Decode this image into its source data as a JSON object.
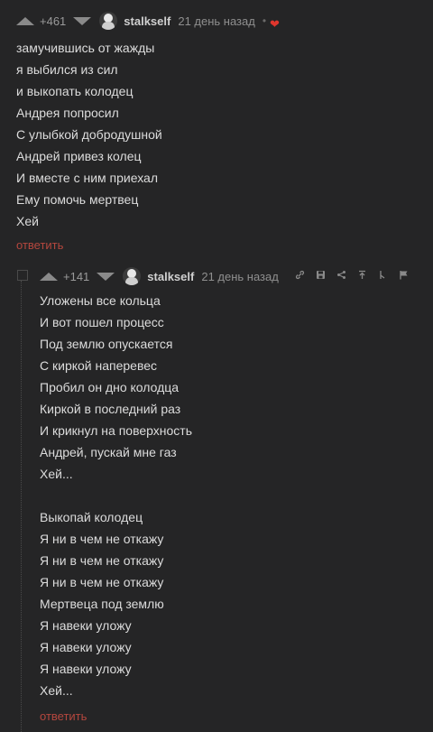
{
  "comments": [
    {
      "rating": "+461",
      "author": "stalkself",
      "time": "21 день назад",
      "body": "замучившись от жажды\nя выбился из сил\nи выкопать колодец\nАндрея попросил\nС улыбкой добродушной\nАндрей привез колец\nИ вместе с ним приехал\nЕму помочь мертвец\nХей",
      "reply": "ответить",
      "heart_icon": "heart-icon",
      "heart_color": "#e0362d"
    },
    {
      "rating": "+141",
      "author": "stalkself",
      "time": "21 день назад",
      "body": "Уложены все кольца\nИ вот пошел процесс\nПод землю опускается\nС киркой наперевес\nПробил он дно колодца\nКиркой в последний раз\nИ крикнул на поверхность\nАндрей, пускай мне газ\nХей...\n\nВыкопай колодец\nЯ ни в чем не откажу\nЯ ни в чем не откажу\nЯ ни в чем не откажу\nМертвеца под землю\nЯ навеки уложу\nЯ навеки уложу\nЯ навеки уложу\nХей...",
      "reply": "ответить",
      "action_icons": [
        "link-icon",
        "save-icon",
        "share-icon",
        "scroll-up-icon",
        "branch-icon",
        "flag-icon"
      ]
    }
  ],
  "colors": {
    "background": "#252526",
    "reply": "#b5473e",
    "text": "#dcdcdc"
  }
}
